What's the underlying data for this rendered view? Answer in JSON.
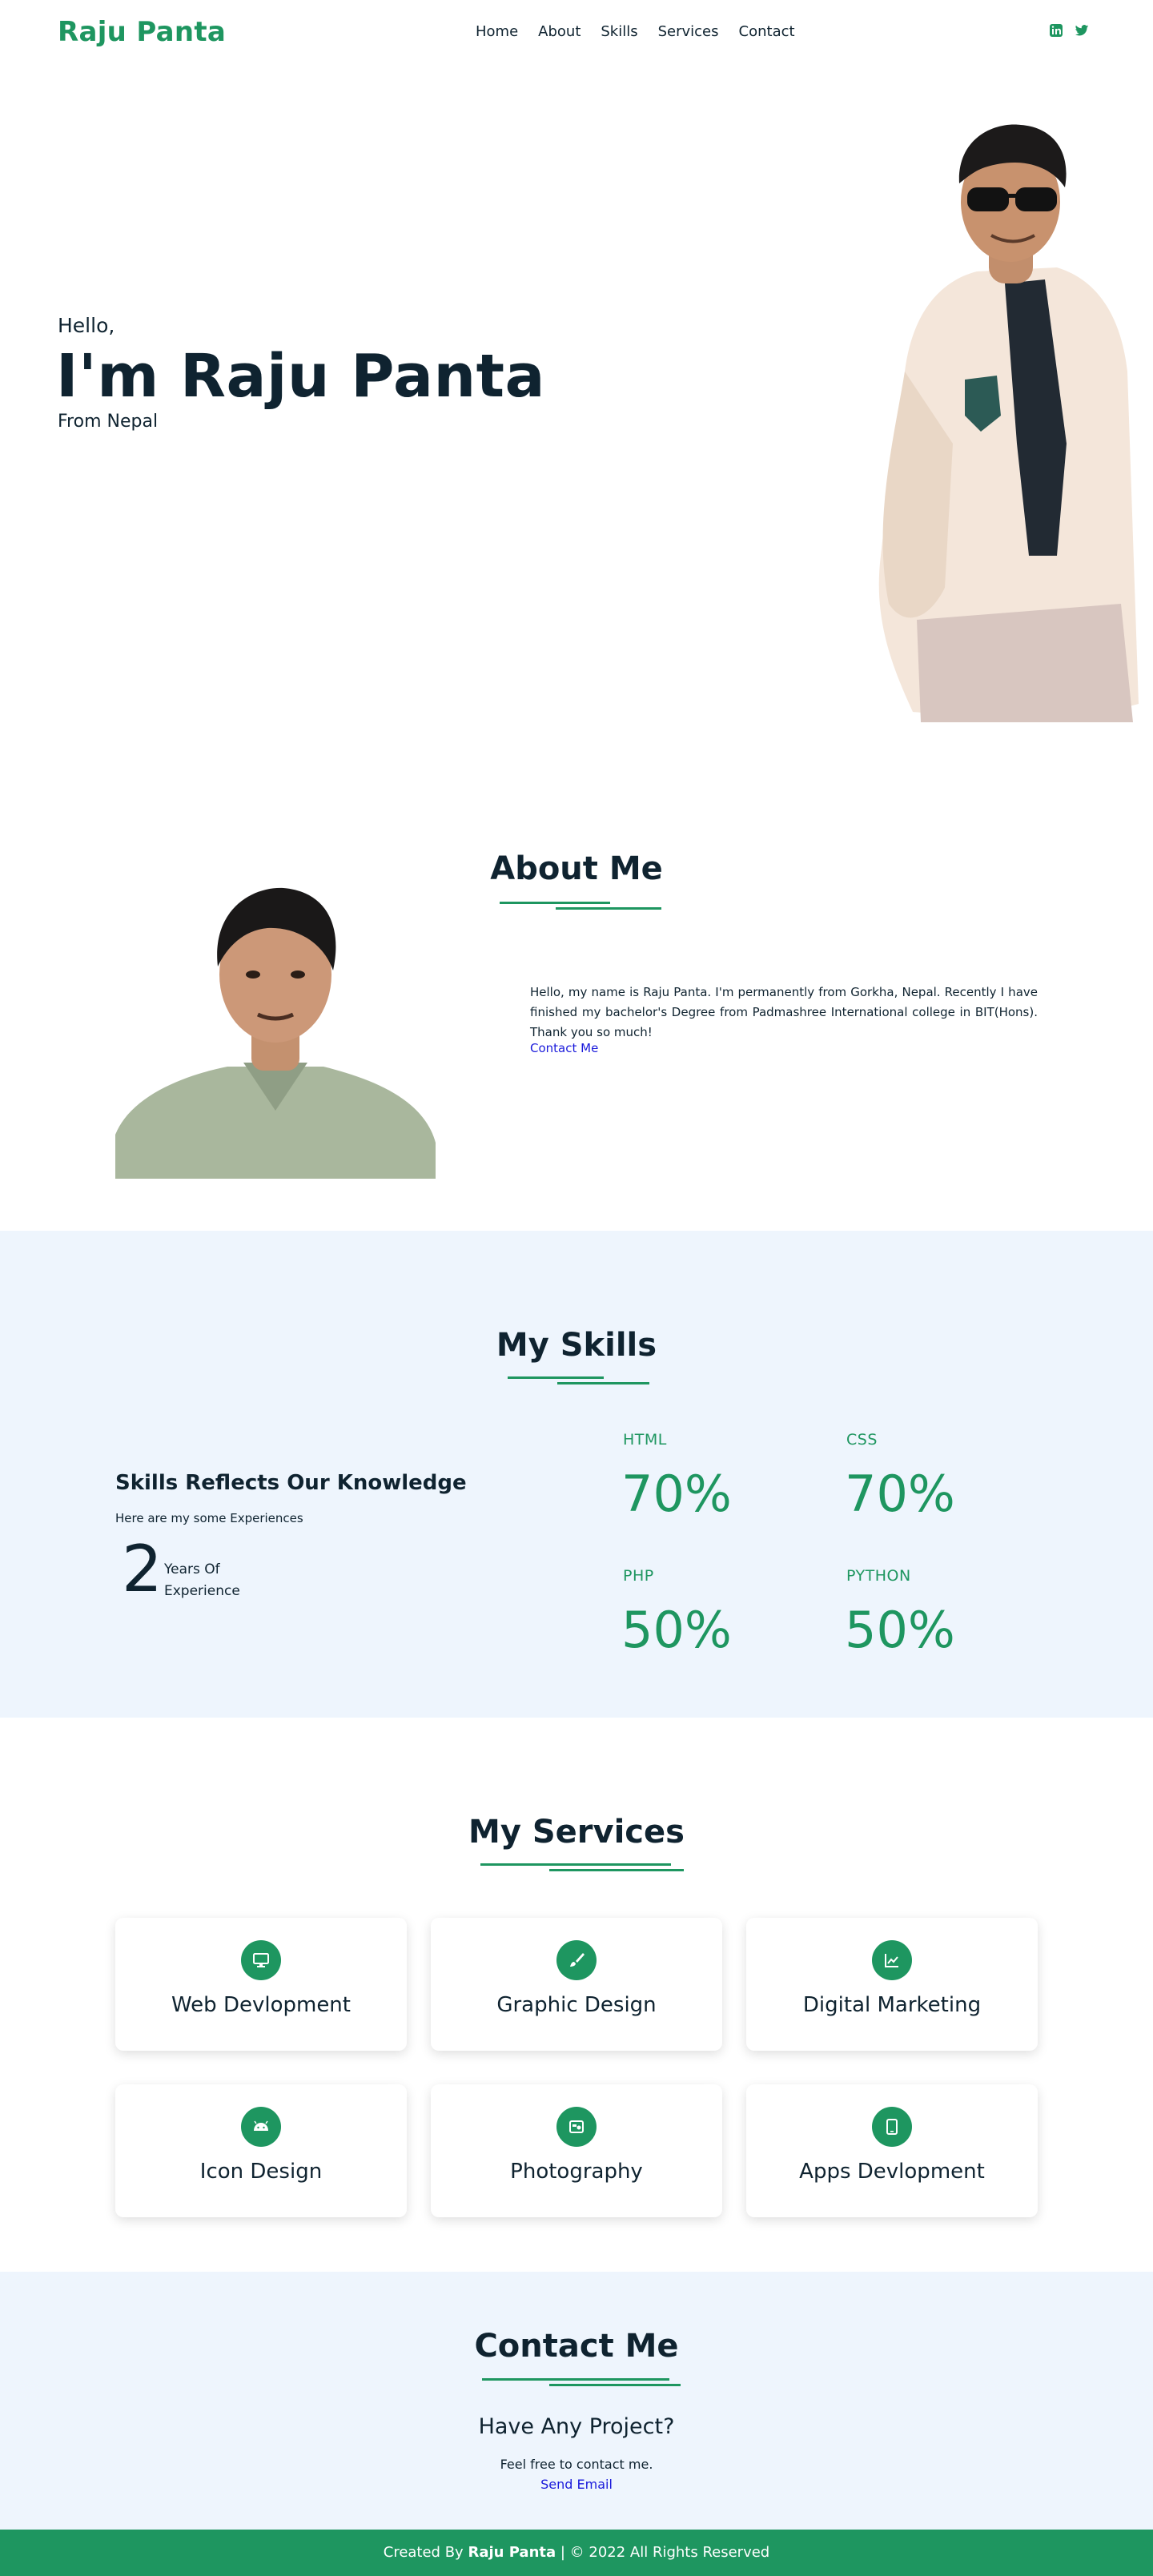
{
  "nav": {
    "logo": "Raju Panta",
    "items": [
      "Home",
      "About",
      "Skills",
      "Services",
      "Contact"
    ],
    "social_icons": [
      "linkedin-icon",
      "twitter-icon"
    ]
  },
  "hero": {
    "greeting": "Hello,",
    "name": "I'm Raju Panta",
    "origin": "From Nepal"
  },
  "about": {
    "title": "About Me",
    "text": "Hello, my name is Raju Panta. I'm permanently from Gorkha, Nepal. Recently I have finished my bachelor's Degree from Padmashree International college in BIT(Hons). Thank you so much!",
    "link": "Contact Me"
  },
  "skills": {
    "title": "My Skills",
    "heading": "Skills Reflects Our Knowledge",
    "subheading": "Here are my some Experiences",
    "years_number": "2",
    "years_label_1": "Years Of",
    "years_label_2": "Experience",
    "items": [
      {
        "name": "HTML",
        "value": "70%"
      },
      {
        "name": "CSS",
        "value": "70%"
      },
      {
        "name": "PHP",
        "value": "50%"
      },
      {
        "name": "PYTHON",
        "value": "50%"
      }
    ]
  },
  "services": {
    "title": "My Services",
    "items": [
      {
        "label": "Web Devlopment",
        "icon": "monitor-icon"
      },
      {
        "label": "Graphic Design",
        "icon": "paintbrush-icon"
      },
      {
        "label": "Digital Marketing",
        "icon": "chart-icon"
      },
      {
        "label": "Icon Design",
        "icon": "android-icon"
      },
      {
        "label": "Photography",
        "icon": "photo-icon"
      },
      {
        "label": "Apps Devlopment",
        "icon": "tablet-icon"
      }
    ]
  },
  "contact": {
    "title": "Contact Me",
    "subtitle": "Have Any Project?",
    "text": "Feel free to contact me.",
    "link": "Send Email"
  },
  "footer": {
    "prefix": "Created By",
    "name": "Raju Panta",
    "suffix": "| © 2022 All Rights Reserved"
  },
  "colors": {
    "accent": "#1e9660",
    "dark": "#0f2330",
    "light_bg": "#eef5fd",
    "link": "#1a1adb"
  }
}
